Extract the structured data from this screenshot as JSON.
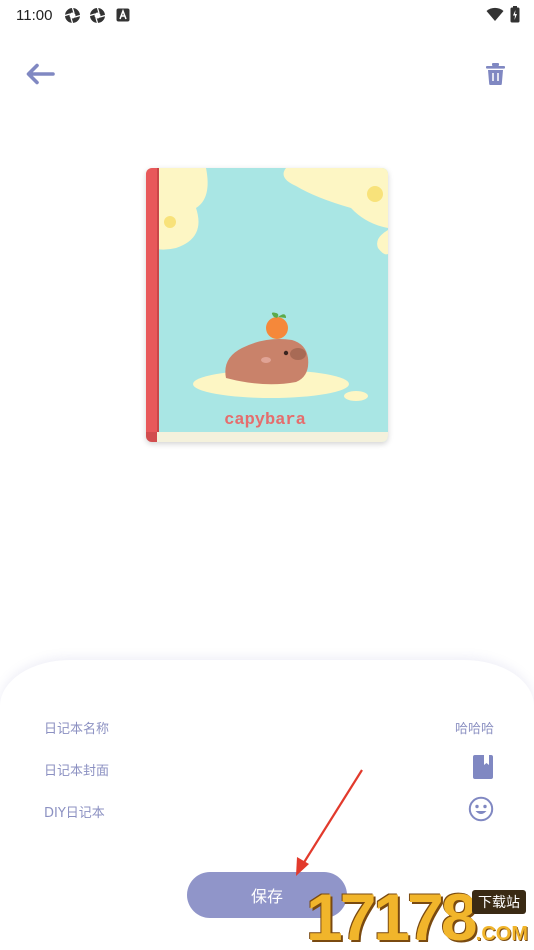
{
  "status_bar": {
    "time": "11:00",
    "icons_left": [
      "camera-aperture-icon",
      "camera-aperture-icon",
      "a-notification-icon"
    ],
    "icons_right": [
      "wifi-icon",
      "battery-icon"
    ]
  },
  "toolbar": {
    "back_icon": "arrow-left-icon",
    "delete_icon": "trash-icon"
  },
  "cover": {
    "title": "capybara",
    "spine_color": "#e8585a",
    "cover_color": "#a9e6e4",
    "accent_color": "#fdf6c4"
  },
  "settings": {
    "name_label": "日记本名称",
    "name_value": "哈哈哈",
    "cover_label": "日记本封面",
    "cover_icon": "book-icon",
    "diy_label": "DIY日记本",
    "diy_icon": "smiley-icon"
  },
  "save_label": "保存",
  "watermark": {
    "number": "17178",
    "tag": "下载站",
    "suffix": ".COM"
  },
  "colors": {
    "accent": "#8c91c2",
    "button": "#9095c9",
    "annotation_arrow": "#e23a2c"
  }
}
